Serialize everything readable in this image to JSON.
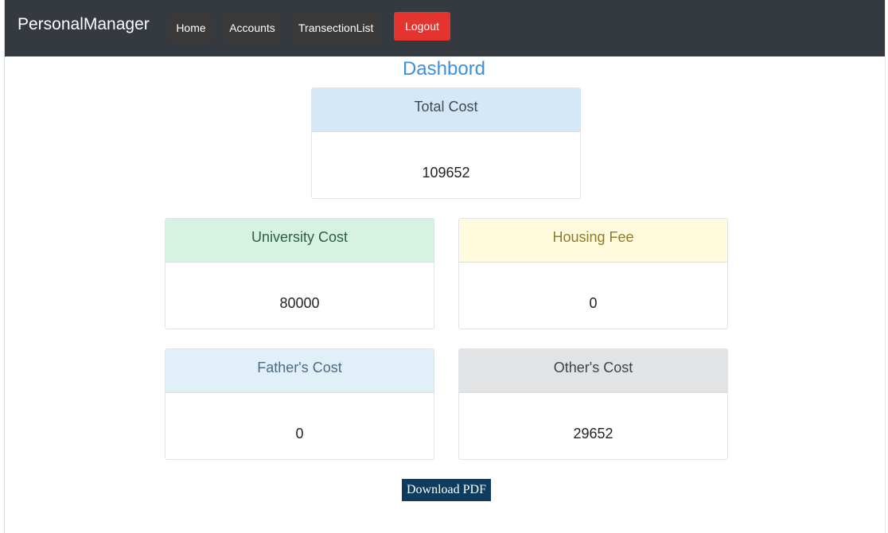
{
  "navbar": {
    "brand": "PersonalManager",
    "items": [
      {
        "label": "Home"
      },
      {
        "label": "Accounts"
      },
      {
        "label": "TransectionList"
      }
    ],
    "logout_label": "Logout"
  },
  "page": {
    "title": "Dashbord"
  },
  "cards": {
    "total": {
      "title": "Total Cost",
      "value": "109652"
    },
    "university": {
      "title": "University Cost",
      "value": "80000"
    },
    "housing": {
      "title": "Housing Fee",
      "value": "0"
    },
    "father": {
      "title": "Father's Cost",
      "value": "0"
    },
    "other": {
      "title": "Other's Cost",
      "value": "29652"
    }
  },
  "actions": {
    "download_pdf_label": "Download PDF"
  },
  "colors": {
    "navbar_bg": "#343a40",
    "logout_bg": "#e3342f",
    "title": "#3f8fd8",
    "pdf_button_bg": "#0e3c5c"
  }
}
